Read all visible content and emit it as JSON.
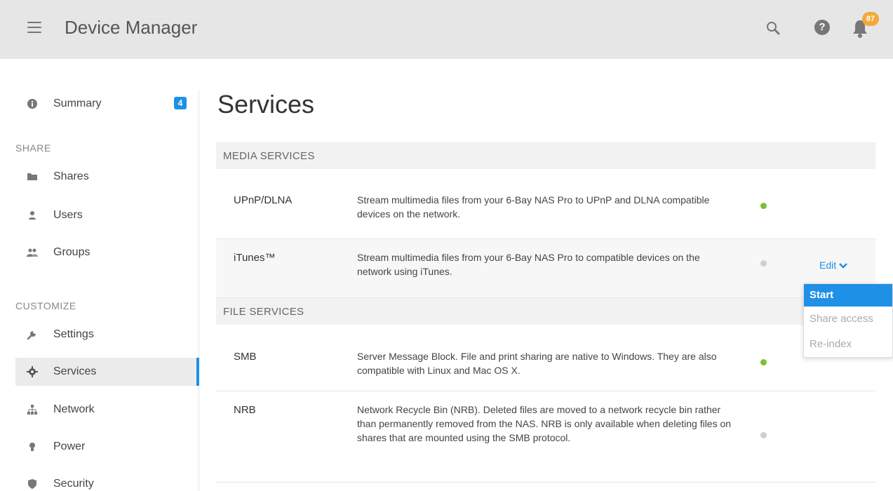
{
  "header": {
    "title": "Device Manager",
    "notification_count": "87",
    "icons": {
      "menu": "hamburger-menu-icon",
      "search": "search-icon",
      "help": "help-icon",
      "notifications": "bell-icon"
    },
    "help_glyph": "?"
  },
  "sidebar": {
    "summary": {
      "label": "Summary",
      "badge": "4",
      "icon": "info-icon"
    },
    "share_heading": "SHARE",
    "share_items": [
      {
        "label": "Shares",
        "icon": "folder-icon"
      },
      {
        "label": "Users",
        "icon": "user-icon"
      },
      {
        "label": "Groups",
        "icon": "group-icon"
      }
    ],
    "customize_heading": "CUSTOMIZE",
    "customize_items": [
      {
        "label": "Settings",
        "icon": "wrench-icon"
      },
      {
        "label": "Services",
        "icon": "gear-icon",
        "active": true
      },
      {
        "label": "Network",
        "icon": "network-icon"
      },
      {
        "label": "Power",
        "icon": "bulb-icon"
      },
      {
        "label": "Security",
        "icon": "shield-icon"
      }
    ]
  },
  "main": {
    "page_title": "Services",
    "media_services": {
      "heading": "MEDIA SERVICES",
      "rows": [
        {
          "name": "UPnP/DLNA",
          "description": "Stream multimedia files from your 6-Bay NAS Pro to UPnP and DLNA compatible devices on the network.",
          "status": "on"
        },
        {
          "name": "iTunes™",
          "description": "Stream multimedia files from your 6-Bay NAS Pro to compatible devices on the network using iTunes.",
          "status": "off",
          "edit_label": "Edit"
        }
      ]
    },
    "file_services": {
      "heading": "FILE SERVICES",
      "rows": [
        {
          "name": "SMB",
          "description": "Server Message Block. File and print sharing are native to Windows. They are also compatible with Linux and Mac OS X.",
          "status": "on"
        },
        {
          "name": "NRB",
          "description": "Network Recycle Bin (NRB). Deleted files are moved to a network recycle bin rather than permanently removed from the NAS. NRB is only available when deleting files on shares that are mounted using the SMB protocol.",
          "status": "off"
        }
      ]
    },
    "edit_menu": [
      "Start",
      "Share access",
      "Re-index"
    ]
  },
  "colors": {
    "accent": "#1e90e6",
    "status_on": "#7cbf35",
    "status_off": "#cfcfcf",
    "badge": "#f2a93b",
    "header_bg": "#e6e6e6"
  }
}
